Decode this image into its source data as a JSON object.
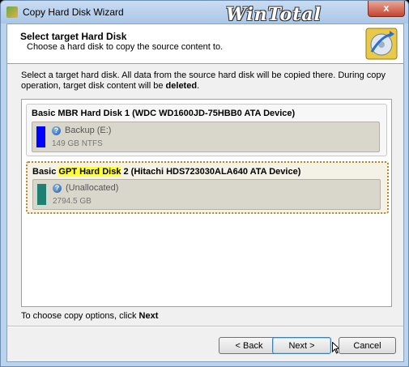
{
  "window": {
    "title": "Copy Hard Disk Wizard",
    "watermark": "WinTotal",
    "close_glyph": "x"
  },
  "header": {
    "title": "Select target Hard Disk",
    "subtitle": "Choose a hard disk to copy the source content to."
  },
  "intro": {
    "text_before": "Select a target hard disk. All data from the source hard disk will be copied there. During copy operation, target disk content will be ",
    "bold": "deleted",
    "text_after": "."
  },
  "disks": [
    {
      "title_pre": "Basic MBR Hard Disk 1 (WDC WD1600JD-75HBB0 ATA Device)",
      "partition": {
        "name": "Backup (E:)",
        "info": "149 GB NTFS",
        "color": "#0000ff",
        "icon": "help-icon"
      }
    },
    {
      "title_pre": "Basic ",
      "title_hl": "GPT Hard Disk",
      "title_post": " 2 (Hitachi HDS723030ALA640 ATA Device)",
      "partition": {
        "name": "(Unallocated)",
        "info": "2794.5 GB",
        "color": "#1e7f73",
        "icon": "help-icon"
      }
    }
  ],
  "footer": {
    "hint_text": "To choose copy options, click ",
    "hint_bold": "Next"
  },
  "buttons": {
    "back": "< Back",
    "next": "Next >",
    "cancel": "Cancel"
  },
  "colors": {
    "highlight": "#ffff33",
    "selected_border": "#b08a2c"
  }
}
